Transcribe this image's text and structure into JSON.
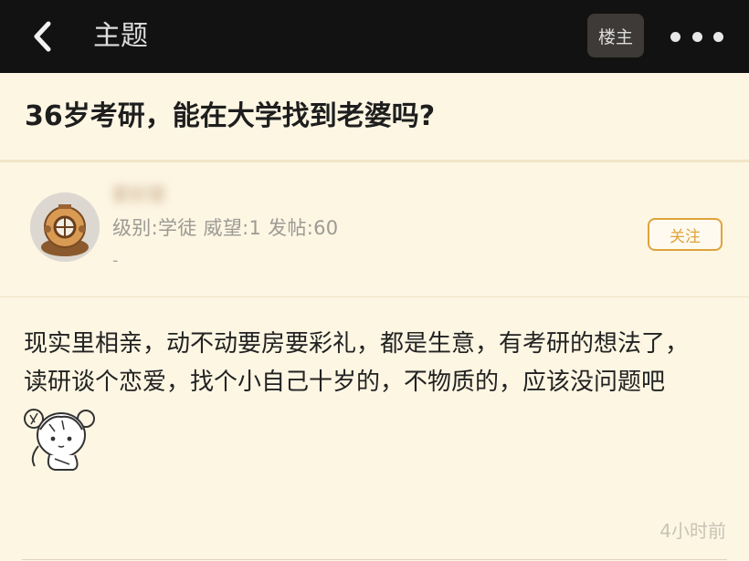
{
  "header": {
    "title": "主题",
    "owner_label": "楼主",
    "back_icon": "chevron-left-icon",
    "more_icon": "more-dots-icon"
  },
  "post": {
    "title": "36岁考研，能在大学找到老婆吗?"
  },
  "author": {
    "name": "爱好是",
    "stats": "级别:学徒 威望:1 发帖:60",
    "signature": "-",
    "follow_label": "关注"
  },
  "content": {
    "lines": [
      "现实里相亲，动不动要房要彩礼，都是生意，有考研的想法了，",
      "读研谈个恋爱，找个小自己十岁的，不物质的，应该没问题吧"
    ],
    "time": "4小时前"
  },
  "colors": {
    "accent": "#dfa33b",
    "background": "#fdf6e3",
    "topbar": "#121212"
  }
}
